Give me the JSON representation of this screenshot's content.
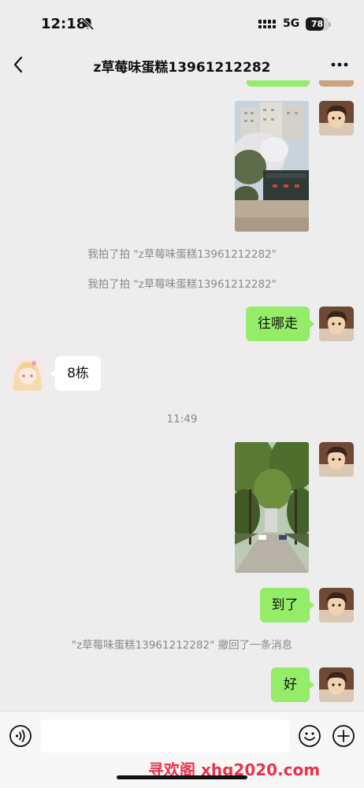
{
  "status_bar": {
    "time": "12:18",
    "network": "5G",
    "battery_level": 78,
    "battery_text": "78",
    "icons": [
      "bell-off-icon",
      "signal-icon",
      "battery-icon"
    ]
  },
  "header": {
    "title": "z草莓味蛋糕13961212282",
    "back_icon": "chevron-left-icon",
    "more_icon": "more-dots-icon"
  },
  "messages": {
    "sys_pat_1": "我拍了拍 \"z草莓味蛋糕13961212282\"",
    "sys_pat_2": "我拍了拍 \"z草莓味蛋糕13961212282\"",
    "msg_where": "往哪走",
    "msg_building": "8栋",
    "time_divider": "11:49",
    "msg_arrived": "到了",
    "sys_recall": "\"z草莓味蛋糕13961212282\" 撤回了一条消息",
    "msg_ok": "好"
  },
  "input_bar": {
    "text_value": "",
    "icons": [
      "voice-icon",
      "emoji-icon",
      "plus-icon"
    ]
  },
  "watermark": "寻欢阁 xhg2020.com",
  "colors": {
    "background": "#ededed",
    "outgoing_bubble": "#95ec69",
    "incoming_bubble": "#ffffff",
    "system_text": "#8a8a8a",
    "watermark": "#e8334c"
  }
}
